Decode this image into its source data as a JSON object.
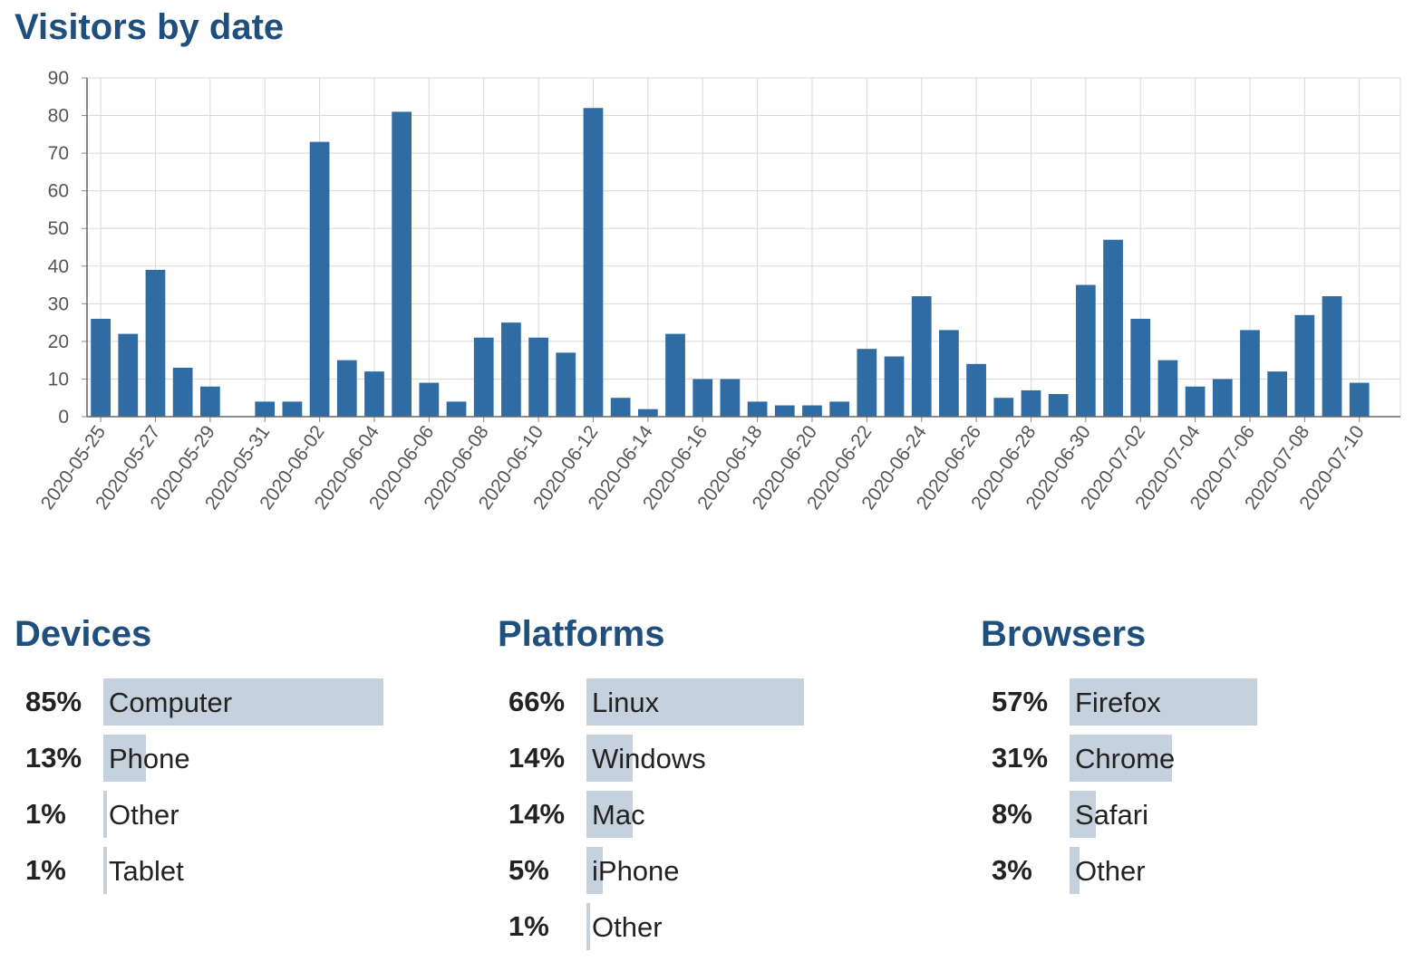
{
  "title": "Visitors by date",
  "colors": {
    "bar": "#2f6ca3",
    "heading": "#1e4f7d",
    "stat_bar": "#c5d1dc"
  },
  "chart_data": {
    "type": "bar",
    "categories": [
      "2020-05-25",
      "2020-05-26",
      "2020-05-27",
      "2020-05-28",
      "2020-05-29",
      "2020-05-30",
      "2020-05-31",
      "2020-06-01",
      "2020-06-02",
      "2020-06-03",
      "2020-06-04",
      "2020-06-05",
      "2020-06-06",
      "2020-06-07",
      "2020-06-08",
      "2020-06-09",
      "2020-06-10",
      "2020-06-11",
      "2020-06-12",
      "2020-06-13",
      "2020-06-14",
      "2020-06-15",
      "2020-06-16",
      "2020-06-17",
      "2020-06-18",
      "2020-06-19",
      "2020-06-20",
      "2020-06-21",
      "2020-06-22",
      "2020-06-23",
      "2020-06-24",
      "2020-06-25",
      "2020-06-26",
      "2020-06-27",
      "2020-06-28",
      "2020-06-29",
      "2020-06-30",
      "2020-07-01",
      "2020-07-02",
      "2020-07-03",
      "2020-07-04",
      "2020-07-05",
      "2020-07-06",
      "2020-07-07",
      "2020-07-08",
      "2020-07-09",
      "2020-07-10",
      "2020-07-11"
    ],
    "values": [
      26,
      22,
      39,
      13,
      8,
      0,
      4,
      4,
      73,
      15,
      12,
      81,
      9,
      4,
      21,
      25,
      21,
      17,
      82,
      5,
      2,
      22,
      10,
      10,
      4,
      3,
      3,
      4,
      18,
      16,
      32,
      23,
      14,
      5,
      7,
      6,
      35,
      47,
      26,
      15,
      8,
      10,
      23,
      12,
      27,
      32,
      9,
      0
    ],
    "x_tick_labels": [
      "2020-05-25",
      "2020-05-27",
      "2020-05-29",
      "2020-05-31",
      "2020-06-02",
      "2020-06-04",
      "2020-06-06",
      "2020-06-08",
      "2020-06-10",
      "2020-06-12",
      "2020-06-14",
      "2020-06-16",
      "2020-06-18",
      "2020-06-20",
      "2020-06-22",
      "2020-06-24",
      "2020-06-26",
      "2020-06-28",
      "2020-06-30",
      "2020-07-02",
      "2020-07-04",
      "2020-07-06",
      "2020-07-08",
      "2020-07-10"
    ],
    "y_ticks": [
      0,
      10,
      20,
      30,
      40,
      50,
      60,
      70,
      80,
      90
    ],
    "ylim": [
      0,
      90
    ],
    "grid": true
  },
  "devices": {
    "heading": "Devices",
    "items": [
      {
        "pct": "85%",
        "label": "Computer",
        "value": 85
      },
      {
        "pct": "13%",
        "label": "Phone",
        "value": 13
      },
      {
        "pct": "1%",
        "label": "Other",
        "value": 1
      },
      {
        "pct": "1%",
        "label": "Tablet",
        "value": 1
      }
    ]
  },
  "platforms": {
    "heading": "Platforms",
    "items": [
      {
        "pct": "66%",
        "label": "Linux",
        "value": 66
      },
      {
        "pct": "14%",
        "label": "Windows",
        "value": 14
      },
      {
        "pct": "14%",
        "label": "Mac",
        "value": 14
      },
      {
        "pct": "5%",
        "label": "iPhone",
        "value": 5
      },
      {
        "pct": "1%",
        "label": "Other",
        "value": 1
      }
    ]
  },
  "browsers": {
    "heading": "Browsers",
    "items": [
      {
        "pct": "57%",
        "label": "Firefox",
        "value": 57
      },
      {
        "pct": "31%",
        "label": "Chrome",
        "value": 31
      },
      {
        "pct": "8%",
        "label": "Safari",
        "value": 8
      },
      {
        "pct": "3%",
        "label": "Other",
        "value": 3
      }
    ]
  }
}
